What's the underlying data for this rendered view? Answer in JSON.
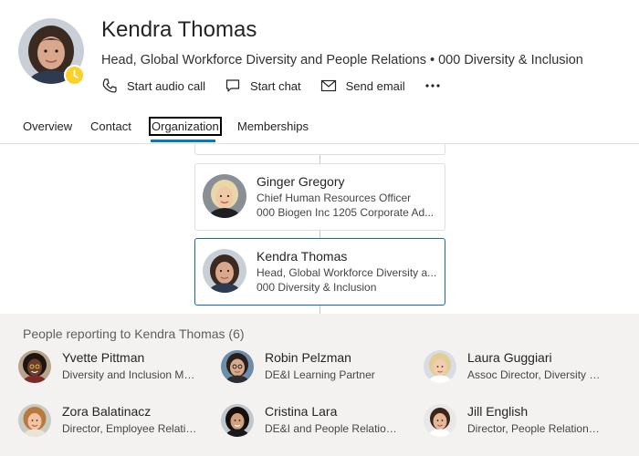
{
  "profile": {
    "name": "Kendra Thomas",
    "title_line": "Head, Global Workforce Diversity and People Relations • 000 Diversity & Inclusion",
    "presence": "away-clock-icon",
    "presence_color": "#f8d22a"
  },
  "actions": {
    "audio_call": "Start audio call",
    "chat": "Start chat",
    "email": "Send email",
    "more": "more-options-icon"
  },
  "tabs": [
    {
      "label": "Overview"
    },
    {
      "label": "Contact"
    },
    {
      "label": "Organization",
      "active": true
    },
    {
      "label": "Memberships"
    }
  ],
  "org": {
    "manager": {
      "name": "Ginger Gregory",
      "title": "Chief Human Resources Officer",
      "dept": "000 Biogen Inc 1205 Corporate Ad..."
    },
    "current": {
      "name": "Kendra Thomas",
      "title": "Head, Global Workforce Diversity a...",
      "dept": "000 Diversity & Inclusion"
    }
  },
  "reports": {
    "heading": "People reporting to Kendra Thomas (6)",
    "people": [
      {
        "name": "Yvette Pittman",
        "title": "Diversity and Inclusion Ma..."
      },
      {
        "name": "Robin Pelzman",
        "title": "DE&I Learning Partner"
      },
      {
        "name": "Laura Guggiari",
        "title": "Assoc Director, Diversity an..."
      },
      {
        "name": "Zora Balatinacz",
        "title": "Director, Employee Relatio..."
      },
      {
        "name": "Cristina Lara",
        "title": "DE&I and People Relations..."
      },
      {
        "name": "Jill English",
        "title": "Director, People Relations,..."
      }
    ]
  },
  "colors": {
    "accent": "#0078d4",
    "selected_border": "#0f6cbd",
    "reports_bg": "#f3f2f1"
  }
}
